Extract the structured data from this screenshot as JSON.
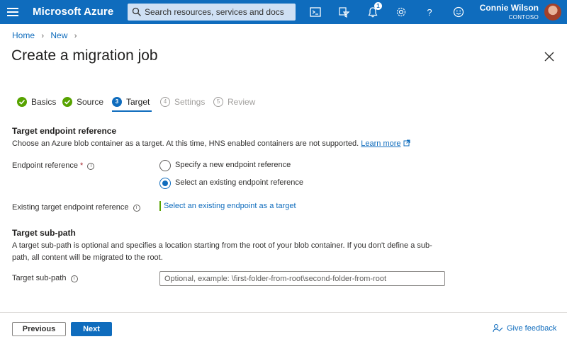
{
  "topbar": {
    "brand": "Microsoft Azure",
    "search_placeholder": "Search resources, services and docs",
    "notification_count": "1",
    "user_name": "Connie Wilson",
    "user_org": "CONTOSO",
    "icons": [
      "menu-icon",
      "search-icon",
      "cloud-shell-icon",
      "directory-filter-icon",
      "bell-icon",
      "gear-icon",
      "help-icon",
      "smiley-icon"
    ]
  },
  "breadcrumb": {
    "items": [
      "Home",
      "New"
    ]
  },
  "page": {
    "title": "Create a migration job"
  },
  "steps": [
    {
      "label": "Basics",
      "state": "done"
    },
    {
      "label": "Source",
      "state": "done"
    },
    {
      "label": "Target",
      "state": "current",
      "num": "3"
    },
    {
      "label": "Settings",
      "state": "todo",
      "num": "4"
    },
    {
      "label": "Review",
      "state": "todo",
      "num": "5"
    }
  ],
  "target_endpoint": {
    "heading": "Target endpoint reference",
    "description": "Choose an Azure blob container as a target. At this time, HNS enabled containers are not supported.",
    "learn_more": "Learn more",
    "endpoint_label": "Endpoint reference",
    "required_mark": "*",
    "options": [
      "Specify a new endpoint reference",
      "Select an existing endpoint reference"
    ],
    "selected_option": "Select an existing endpoint reference",
    "existing_label": "Existing target endpoint reference",
    "existing_link": "Select an existing endpoint as a target"
  },
  "subpath": {
    "heading": "Target sub-path",
    "description": "A target sub-path is optional and specifies a location starting from the root of your blob container. If you don't define a sub-path, all content will be migrated to the root.",
    "label": "Target sub-path",
    "placeholder": "Optional, example: \\first-folder-from-root\\second-folder-from-root",
    "value": ""
  },
  "footer": {
    "previous": "Previous",
    "next": "Next",
    "feedback": "Give feedback"
  },
  "colors": {
    "accent": "#0f6cbd",
    "success": "#57a300",
    "required": "#a4262c"
  }
}
